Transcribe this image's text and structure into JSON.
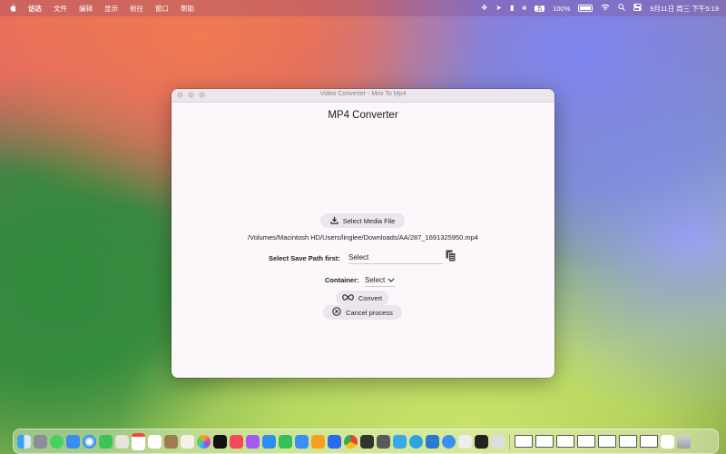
{
  "menubar": {
    "apple_icon": "apple-icon",
    "items": [
      "访达",
      "文件",
      "编辑",
      "显示",
      "前往",
      "窗口",
      "帮助"
    ],
    "status": {
      "ime": "五",
      "battery": "100%",
      "datetime": "9月11日 周三 下午5:19"
    }
  },
  "window": {
    "title": "Video Converter - Mov To Mp4",
    "heading": "MP4 Converter",
    "select_media_label": "Select Media File",
    "file_path": "/Volumes/Macintosh HD/Users/linglee/Downloads/AA/287_1691325950.mp4",
    "save_path_label": "Select Save Path first:",
    "save_path_value": "Select",
    "container_label": "Container:",
    "container_value": "Select",
    "convert_label": "Convert",
    "cancel_label": "Cancel process"
  },
  "dock": {
    "apps": [
      "finder",
      "launchpad",
      "messages",
      "mail",
      "safari",
      "facetime",
      "preview",
      "calendar",
      "reminders",
      "notes",
      "photos",
      "appletv",
      "music",
      "podcasts",
      "appstore",
      "numbers",
      "keynote",
      "pages",
      "sketch",
      "shortcuts",
      "chrome",
      "activity",
      "slack",
      "telegram",
      "vscode",
      "proxy",
      "terminal",
      "chatgpt",
      "trash"
    ]
  },
  "colors": {
    "window_bg": "#fbf7fb",
    "button_bg": "#ece6ec"
  }
}
